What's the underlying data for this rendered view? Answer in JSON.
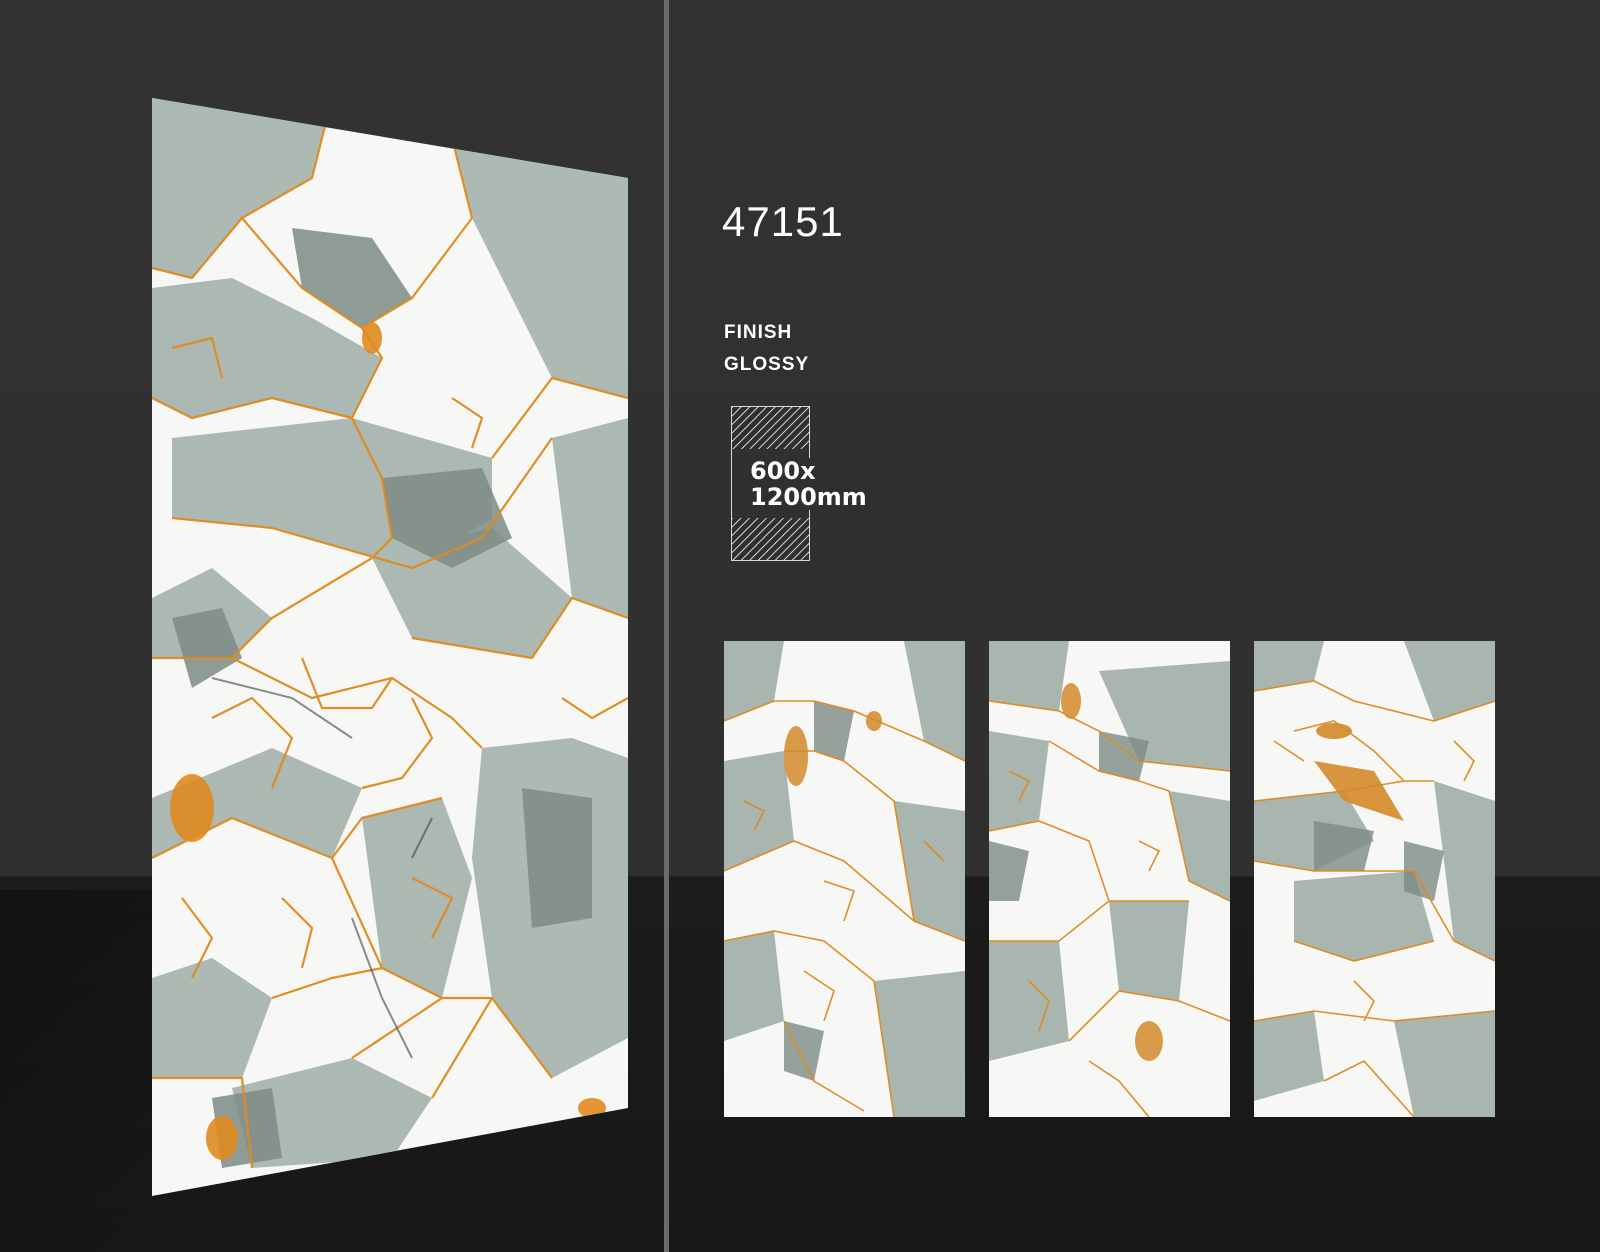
{
  "product": {
    "code": "47151",
    "finish_label": "FINISH",
    "finish_value": "GLOSSY",
    "size_line1": "600x",
    "size_line2": "1200mm"
  },
  "colors": {
    "background": "#2f2f30",
    "divider": "#6b6b6d",
    "marble_base": "#f6f6f4",
    "marble_green": "#a9b7b0",
    "marble_dark": "#7f8d86",
    "vein_gold": "#e08a1e"
  }
}
